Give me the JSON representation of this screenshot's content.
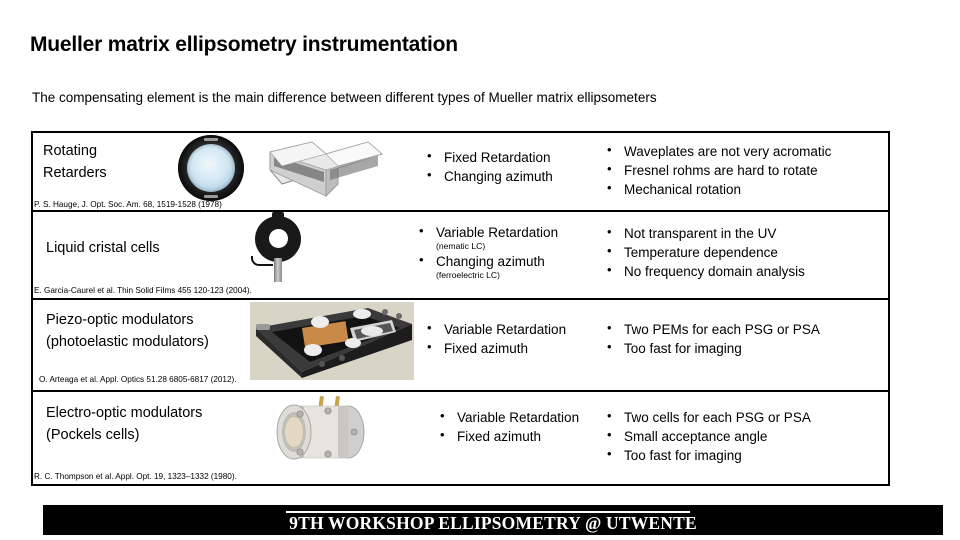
{
  "slide": {
    "title": "Mueller matrix ellipsometry instrumentation",
    "subtitle": "The compensating element is the main difference between different types of Mueller matrix ellipsometers"
  },
  "table": {
    "rows": [
      {
        "name_line1": "Rotating",
        "name_line2": "Retarders",
        "citation": "P. S. Hauge, J. Opt. Soc. Am. 68, 1519-1528 (1978)",
        "properties": [
          {
            "text": "Fixed Retardation",
            "sub": ""
          },
          {
            "text": "Changing azimuth",
            "sub": ""
          }
        ],
        "drawbacks": [
          "Waveplates are not very acromatic",
          "Fresnel rohms are hard to rotate",
          "Mechanical rotation"
        ],
        "images": [
          "waveplate-mount",
          "fresnel-rhomb"
        ]
      },
      {
        "name_line1": "Liquid cristal cells",
        "name_line2": "",
        "citation": "E. Garcia-Caurel et al. Thin Solid Films 455 120-123 (2004).",
        "properties": [
          {
            "text": "Variable Retardation",
            "sub": "(nematic LC)"
          },
          {
            "text": "Changing azimuth",
            "sub": "(ferroelectric LC)"
          }
        ],
        "drawbacks": [
          "Not transparent in the UV",
          "Temperature dependence",
          "No frequency domain analysis"
        ],
        "images": [
          "liquid-crystal-cell"
        ]
      },
      {
        "name_line1": "Piezo-optic modulators",
        "name_line2": "(photoelastic modulators)",
        "citation": "O. Arteaga et al. Appl. Optics 51.28 6805-6817 (2012).",
        "properties": [
          {
            "text": "Variable Retardation",
            "sub": ""
          },
          {
            "text": "Fixed azimuth",
            "sub": ""
          }
        ],
        "drawbacks": [
          "Two PEMs for each PSG or PSA",
          "Too fast for imaging"
        ],
        "images": [
          "photoelastic-modulator"
        ]
      },
      {
        "name_line1": "Electro-optic modulators",
        "name_line2": "(Pockels cells)",
        "citation": "R. C. Thompson et al. Appl. Opt. 19, 1323–1332 (1980).",
        "properties": [
          {
            "text": "Variable Retardation",
            "sub": ""
          },
          {
            "text": "Fixed azimuth",
            "sub": ""
          }
        ],
        "drawbacks": [
          "Two cells for each PSG or PSA",
          "Small acceptance angle",
          "Too fast for imaging"
        ],
        "images": [
          "pockels-cell"
        ]
      }
    ]
  },
  "footer": {
    "text": "9TH WORKSHOP ELLIPSOMETRY @ UTWENTE",
    "background": "#000000",
    "color": "#ffffff"
  }
}
